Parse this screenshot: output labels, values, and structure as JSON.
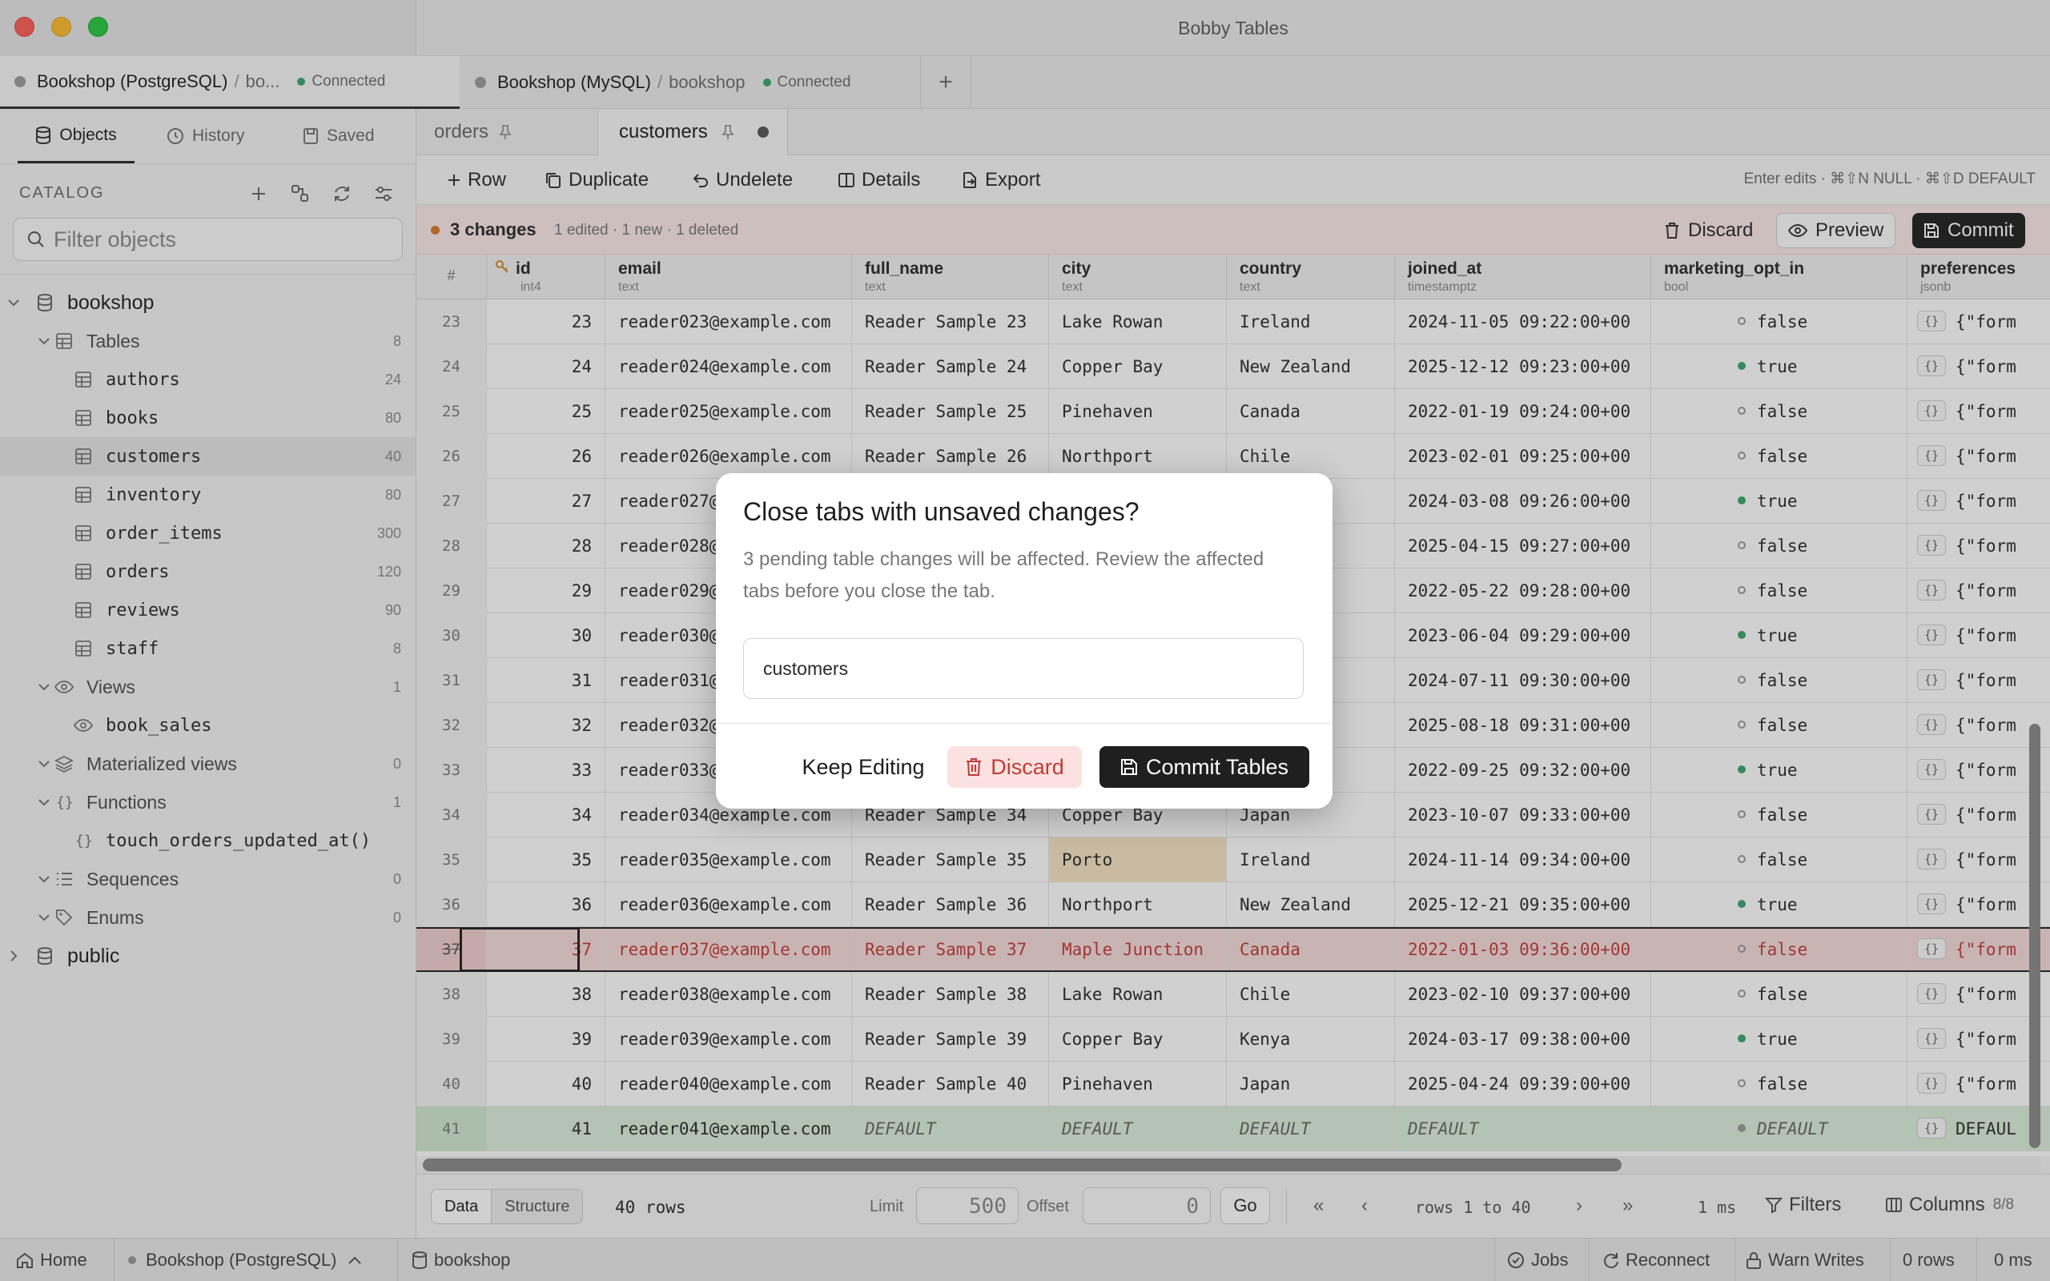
{
  "window": {
    "title": "Bobby Tables"
  },
  "connection_tabs": [
    {
      "name": "Bookshop (PostgreSQL)",
      "db": "bo...",
      "status": "Connected"
    },
    {
      "name": "Bookshop (MySQL)",
      "db": "bookshop",
      "status": "Connected"
    }
  ],
  "sidebar": {
    "tabs": [
      "Objects",
      "History",
      "Saved"
    ],
    "catalog_label": "CATALOG",
    "filter_placeholder": "Filter objects",
    "tree": [
      {
        "label": "bookshop",
        "count": ""
      },
      {
        "label": "Tables",
        "count": "8"
      },
      {
        "label": "authors",
        "count": "24"
      },
      {
        "label": "books",
        "count": "80"
      },
      {
        "label": "customers",
        "count": "40"
      },
      {
        "label": "inventory",
        "count": "80"
      },
      {
        "label": "order_items",
        "count": "300"
      },
      {
        "label": "orders",
        "count": "120"
      },
      {
        "label": "reviews",
        "count": "90"
      },
      {
        "label": "staff",
        "count": "8"
      },
      {
        "label": "Views",
        "count": "1"
      },
      {
        "label": "book_sales",
        "count": ""
      },
      {
        "label": "Materialized views",
        "count": "0"
      },
      {
        "label": "Functions",
        "count": "1"
      },
      {
        "label": "touch_orders_updated_at()",
        "count": ""
      },
      {
        "label": "Sequences",
        "count": "0"
      },
      {
        "label": "Enums",
        "count": "0"
      },
      {
        "label": "public",
        "count": ""
      }
    ]
  },
  "editor_tabs": [
    "orders",
    "customers"
  ],
  "toolbar": {
    "row": "Row",
    "duplicate": "Duplicate",
    "undelete": "Undelete",
    "details": "Details",
    "export": "Export",
    "hint": "Enter edits · ⌘⇧N NULL · ⌘⇧D DEFAULT"
  },
  "changes": {
    "count": "3 changes",
    "detail": "1 edited · 1 new · 1 deleted",
    "discard": "Discard",
    "preview": "Preview",
    "commit": "Commit"
  },
  "grid": {
    "columns": [
      {
        "name": "#",
        "type": ""
      },
      {
        "name": "id",
        "type": "int4"
      },
      {
        "name": "email",
        "type": "text"
      },
      {
        "name": "full_name",
        "type": "text"
      },
      {
        "name": "city",
        "type": "text"
      },
      {
        "name": "country",
        "type": "text"
      },
      {
        "name": "joined_at",
        "type": "timestamptz"
      },
      {
        "name": "marketing_opt_in",
        "type": "bool"
      },
      {
        "name": "preferences",
        "type": "jsonb"
      }
    ],
    "json_badge": "{}",
    "rows": [
      {
        "rn": "23",
        "id": "23",
        "email": "reader023@example.com",
        "full_name": "Reader Sample 23",
        "city": "Lake Rowan",
        "country": "Ireland",
        "joined_at": "2024-11-05 09:22:00+00",
        "opt": "false",
        "prefs": "{\"form"
      },
      {
        "rn": "24",
        "id": "24",
        "email": "reader024@example.com",
        "full_name": "Reader Sample 24",
        "city": "Copper Bay",
        "country": "New Zealand",
        "joined_at": "2025-12-12 09:23:00+00",
        "opt": "true",
        "prefs": "{\"form"
      },
      {
        "rn": "25",
        "id": "25",
        "email": "reader025@example.com",
        "full_name": "Reader Sample 25",
        "city": "Pinehaven",
        "country": "Canada",
        "joined_at": "2022-01-19 09:24:00+00",
        "opt": "false",
        "prefs": "{\"form"
      },
      {
        "rn": "26",
        "id": "26",
        "email": "reader026@example.com",
        "full_name": "Reader Sample 26",
        "city": "Northport",
        "country": "Chile",
        "joined_at": "2023-02-01 09:25:00+00",
        "opt": "false",
        "prefs": "{\"form"
      },
      {
        "rn": "27",
        "id": "27",
        "email": "reader027@",
        "full_name": "",
        "city": "",
        "country": "",
        "joined_at": "2024-03-08 09:26:00+00",
        "opt": "true",
        "prefs": "{\"form"
      },
      {
        "rn": "28",
        "id": "28",
        "email": "reader028@",
        "full_name": "",
        "city": "",
        "country": "",
        "joined_at": "2025-04-15 09:27:00+00",
        "opt": "false",
        "prefs": "{\"form"
      },
      {
        "rn": "29",
        "id": "29",
        "email": "reader029@",
        "full_name": "",
        "city": "",
        "country": "",
        "joined_at": "2022-05-22 09:28:00+00",
        "opt": "false",
        "prefs": "{\"form"
      },
      {
        "rn": "30",
        "id": "30",
        "email": "reader030@",
        "full_name": "",
        "city": "",
        "country": "nd",
        "joined_at": "2023-06-04 09:29:00+00",
        "opt": "true",
        "prefs": "{\"form"
      },
      {
        "rn": "31",
        "id": "31",
        "email": "reader031@",
        "full_name": "",
        "city": "",
        "country": "",
        "joined_at": "2024-07-11 09:30:00+00",
        "opt": "false",
        "prefs": "{\"form"
      },
      {
        "rn": "32",
        "id": "32",
        "email": "reader032@",
        "full_name": "",
        "city": "",
        "country": "",
        "joined_at": "2025-08-18 09:31:00+00",
        "opt": "false",
        "prefs": "{\"form"
      },
      {
        "rn": "33",
        "id": "33",
        "email": "reader033@",
        "full_name": "",
        "city": "",
        "country": "",
        "joined_at": "2022-09-25 09:32:00+00",
        "opt": "true",
        "prefs": "{\"form"
      },
      {
        "rn": "34",
        "id": "34",
        "email": "reader034@example.com",
        "full_name": "Reader Sample 34",
        "city": "Copper Bay",
        "country": "Japan",
        "joined_at": "2023-10-07 09:33:00+00",
        "opt": "false",
        "prefs": "{\"form"
      },
      {
        "rn": "35",
        "id": "35",
        "email": "reader035@example.com",
        "full_name": "Reader Sample 35",
        "city": "Porto",
        "country": "Ireland",
        "joined_at": "2024-11-14 09:34:00+00",
        "opt": "false",
        "prefs": "{\"form",
        "edited": "city"
      },
      {
        "rn": "36",
        "id": "36",
        "email": "reader036@example.com",
        "full_name": "Reader Sample 36",
        "city": "Northport",
        "country": "New Zealand",
        "joined_at": "2025-12-21 09:35:00+00",
        "opt": "true",
        "prefs": "{\"form"
      },
      {
        "rn": "37",
        "id": "37",
        "email": "reader037@example.com",
        "full_name": "Reader Sample 37",
        "city": "Maple Junction",
        "country": "Canada",
        "joined_at": "2022-01-03 09:36:00+00",
        "opt": "false",
        "prefs": "{\"form",
        "state": "deleted"
      },
      {
        "rn": "38",
        "id": "38",
        "email": "reader038@example.com",
        "full_name": "Reader Sample 38",
        "city": "Lake Rowan",
        "country": "Chile",
        "joined_at": "2023-02-10 09:37:00+00",
        "opt": "false",
        "prefs": "{\"form"
      },
      {
        "rn": "39",
        "id": "39",
        "email": "reader039@example.com",
        "full_name": "Reader Sample 39",
        "city": "Copper Bay",
        "country": "Kenya",
        "joined_at": "2024-03-17 09:38:00+00",
        "opt": "true",
        "prefs": "{\"form"
      },
      {
        "rn": "40",
        "id": "40",
        "email": "reader040@example.com",
        "full_name": "Reader Sample 40",
        "city": "Pinehaven",
        "country": "Japan",
        "joined_at": "2025-04-24 09:39:00+00",
        "opt": "false",
        "prefs": "{\"form"
      },
      {
        "rn": "41",
        "id": "41",
        "email": "reader041@example.com",
        "full_name": "DEFAULT",
        "city": "DEFAULT",
        "country": "DEFAULT",
        "joined_at": "DEFAULT",
        "opt": "DEFAULT",
        "prefs": "DEFAUL",
        "state": "inserted"
      }
    ]
  },
  "footer": {
    "data_tab": "Data",
    "structure_tab": "Structure",
    "rows": "40 rows",
    "limit_label": "Limit",
    "limit_value": "500",
    "offset_label": "Offset",
    "offset_value": "0",
    "go": "Go",
    "range": "rows 1 to 40",
    "time": "1 ms",
    "filters": "Filters",
    "columns": "Columns",
    "columns_count": "8/8"
  },
  "statusbar": {
    "home": "Home",
    "connection": "Bookshop (PostgreSQL)",
    "database": "bookshop",
    "jobs": "Jobs",
    "reconnect": "Reconnect",
    "warn": "Warn Writes",
    "rows": "0 rows",
    "time": "0 ms"
  },
  "modal": {
    "title": "Close tabs with unsaved changes?",
    "body": "3 pending table changes will be affected. Review the affected tabs before you close the tab.",
    "item": "customers",
    "keep": "Keep Editing",
    "discard": "Discard",
    "commit": "Commit Tables"
  },
  "colors": {
    "accent": "#1f1f1f",
    "connected": "#3aa66a",
    "deleted_bg": "#f6dcdb",
    "inserted_bg": "#dcefdc",
    "edited_bg": "#f7e4c4",
    "danger": "#c23b36"
  }
}
